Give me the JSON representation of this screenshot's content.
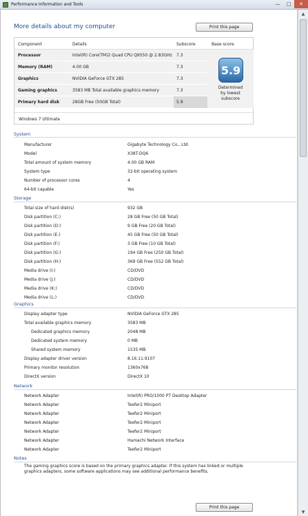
{
  "window": {
    "title": "Performance Information and Tools"
  },
  "heading": "More details about my computer",
  "print_label": "Print this page",
  "table": {
    "headers": [
      "Component",
      "Details",
      "Subscore",
      "Base score"
    ],
    "rows": [
      {
        "component": "Processor",
        "details": "Intel(R) Core(TM)2 Quad CPU Q9550 @ 2.83GHz",
        "subscore": "7.3"
      },
      {
        "component": "Memory (RAM)",
        "details": "4.00 GB",
        "subscore": "7.3"
      },
      {
        "component": "Graphics",
        "details": "NVIDIA GeForce GTX 285",
        "subscore": "7.3"
      },
      {
        "component": "Gaming graphics",
        "details": "3583 MB Total available graphics memory",
        "subscore": "7.3"
      },
      {
        "component": "Primary hard disk",
        "details": "28GB Free (50GB Total)",
        "subscore": "5.9"
      }
    ],
    "base_score": "5.9",
    "base_note": "Determined by lowest subscore",
    "os": "Windows 7 Ultimate"
  },
  "system": {
    "title": "System",
    "items": [
      {
        "k": "Manufacturer",
        "v": "Gigabyte Technology Co., Ltd."
      },
      {
        "k": "Model",
        "v": "X38T-DQ6"
      },
      {
        "k": "Total amount of system memory",
        "v": "4.00 GB RAM"
      },
      {
        "k": "System type",
        "v": "32-bit operating system"
      },
      {
        "k": "Number of processor cores",
        "v": "4"
      },
      {
        "k": "64-bit capable",
        "v": "Yes"
      }
    ]
  },
  "storage": {
    "title": "Storage",
    "items": [
      {
        "k": "Total size of hard disk(s)",
        "v": "932 GB"
      },
      {
        "k": "Disk partition (C:)",
        "v": "28 GB Free (50 GB Total)"
      },
      {
        "k": "Disk partition (D:)",
        "v": "9 GB Free (20 GB Total)"
      },
      {
        "k": "Disk partition (E:)",
        "v": "45 GB Free (50 GB Total)"
      },
      {
        "k": "Disk partition (F:)",
        "v": "3 GB Free (10 GB Total)"
      },
      {
        "k": "Disk partition (G:)",
        "v": "194 GB Free (250 GB Total)"
      },
      {
        "k": "Disk partition (H:)",
        "v": "369 GB Free (552 GB Total)"
      },
      {
        "k": "Media drive (I:)",
        "v": "CD/DVD"
      },
      {
        "k": "Media drive (J:)",
        "v": "CD/DVD"
      },
      {
        "k": "Media drive (K:)",
        "v": "CD/DVD"
      },
      {
        "k": "Media drive (L:)",
        "v": "CD/DVD"
      }
    ]
  },
  "graphics": {
    "title": "Graphics",
    "items": [
      {
        "k": "Display adapter type",
        "v": "NVIDIA GeForce GTX 285",
        "indent": 0
      },
      {
        "k": "Total available graphics memory",
        "v": "3583 MB",
        "indent": 0
      },
      {
        "k": "Dedicated graphics memory",
        "v": "2048 MB",
        "indent": 1
      },
      {
        "k": "Dedicated system memory",
        "v": "0 MB",
        "indent": 1
      },
      {
        "k": "Shared system memory",
        "v": "1535 MB",
        "indent": 1
      },
      {
        "k": "Display adapter driver version",
        "v": "8.16.11.9107",
        "indent": 0
      },
      {
        "k": "Primary monitor resolution",
        "v": "1360x768",
        "indent": 0
      },
      {
        "k": "DirectX version",
        "v": "DirectX 10",
        "indent": 0
      }
    ]
  },
  "network": {
    "title": "Network",
    "items": [
      {
        "k": "Network Adapter",
        "v": "Intel(R) PRO/1000 PT Desktop Adapter"
      },
      {
        "k": "Network Adapter",
        "v": "Teefer2 Miniport"
      },
      {
        "k": "Network Adapter",
        "v": "Teefer2 Miniport"
      },
      {
        "k": "Network Adapter",
        "v": "Teefer2 Miniport"
      },
      {
        "k": "Network Adapter",
        "v": "Teefer2 Miniport"
      },
      {
        "k": "Network Adapter",
        "v": "Hamachi Network Interface"
      },
      {
        "k": "Network Adapter",
        "v": "Teefer2 Miniport"
      }
    ]
  },
  "notes": {
    "title": "Notes",
    "text": "The gaming graphics score is based on the primary graphics adapter. If this system has linked or multiple graphics adapters, some software applications may see additional performance benefits."
  },
  "icons": {
    "app": "performance-icon",
    "min": "minimize-icon",
    "max": "maximize-icon",
    "close": "close-icon"
  }
}
